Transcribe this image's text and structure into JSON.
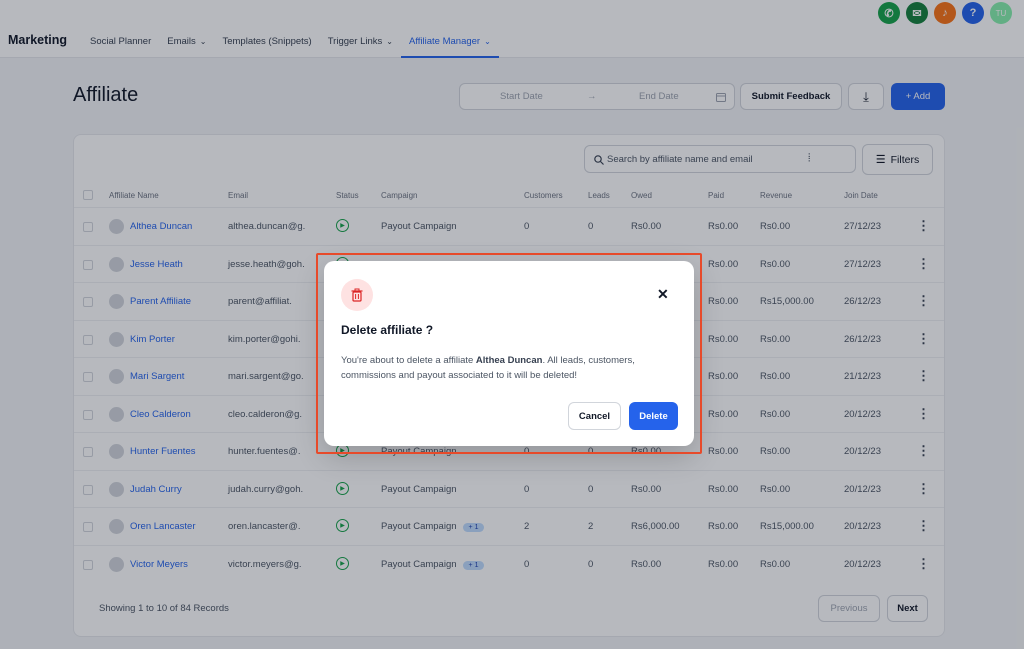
{
  "header": {
    "brand": "Marketing",
    "nav": [
      {
        "label": "Social Planner",
        "chevron": false,
        "active": false
      },
      {
        "label": "Emails",
        "chevron": true,
        "active": false
      },
      {
        "label": "Templates (Snippets)",
        "chevron": false,
        "active": false
      },
      {
        "label": "Trigger Links",
        "chevron": true,
        "active": false
      },
      {
        "label": "Affiliate Manager",
        "chevron": true,
        "active": true
      }
    ],
    "icons": [
      {
        "name": "phone-icon",
        "color": "#16a34a",
        "glyph": "✆"
      },
      {
        "name": "megaphone-icon",
        "color": "#15803d",
        "glyph": "✉"
      },
      {
        "name": "bell-icon",
        "color": "#f97316",
        "glyph": "♪"
      },
      {
        "name": "help-icon",
        "color": "#2563eb",
        "glyph": "?"
      },
      {
        "name": "user-avatar",
        "color": "#86efac",
        "glyph": "TU"
      }
    ]
  },
  "page": {
    "title": "Affiliate",
    "start_date_placeholder": "Start Date",
    "arrow": "→",
    "end_date_placeholder": "End Date",
    "submit_feedback": "Submit Feedback",
    "download_glyph": "⤓",
    "add_label": "+ Add"
  },
  "table": {
    "search_placeholder": "Search by affiliate name and email",
    "filters_label": "Filters",
    "columns": [
      "Affiliate Name",
      "Email",
      "Status",
      "Campaign",
      "Customers",
      "Leads",
      "Owed",
      "Paid",
      "Revenue",
      "Join Date"
    ],
    "rows": [
      {
        "name": "Althea Duncan",
        "email": "althea.duncan@g.",
        "campaign": "Payout Campaign",
        "badge": "",
        "customers": "0",
        "leads": "0",
        "owed": "Rs0.00",
        "paid": "Rs0.00",
        "revenue": "Rs0.00",
        "join": "27/12/23"
      },
      {
        "name": "Jesse Heath",
        "email": "jesse.heath@goh.",
        "campaign": "",
        "badge": "",
        "customers": "",
        "leads": "",
        "owed": "",
        "paid": "Rs0.00",
        "revenue": "Rs0.00",
        "join": "27/12/23"
      },
      {
        "name": "Parent Affiliate",
        "email": "parent@affiliat.",
        "campaign": "",
        "badge": "",
        "customers": "",
        "leads": "",
        "owed": "",
        "paid": "Rs0.00",
        "revenue": "Rs15,000.00",
        "join": "26/12/23"
      },
      {
        "name": "Kim Porter",
        "email": "kim.porter@gohi.",
        "campaign": "",
        "badge": "",
        "customers": "",
        "leads": "",
        "owed": "",
        "paid": "Rs0.00",
        "revenue": "Rs0.00",
        "join": "26/12/23"
      },
      {
        "name": "Mari Sargent",
        "email": "mari.sargent@go.",
        "campaign": "",
        "badge": "",
        "customers": "",
        "leads": "",
        "owed": "",
        "paid": "Rs0.00",
        "revenue": "Rs0.00",
        "join": "21/12/23"
      },
      {
        "name": "Cleo Calderon",
        "email": "cleo.calderon@g.",
        "campaign": "",
        "badge": "",
        "customers": "",
        "leads": "",
        "owed": "",
        "paid": "Rs0.00",
        "revenue": "Rs0.00",
        "join": "20/12/23"
      },
      {
        "name": "Hunter Fuentes",
        "email": "hunter.fuentes@.",
        "campaign": "Payout Campaign",
        "badge": "",
        "customers": "0",
        "leads": "0",
        "owed": "Rs0.00",
        "paid": "Rs0.00",
        "revenue": "Rs0.00",
        "join": "20/12/23"
      },
      {
        "name": "Judah Curry",
        "email": "judah.curry@goh.",
        "campaign": "Payout Campaign",
        "badge": "",
        "customers": "0",
        "leads": "0",
        "owed": "Rs0.00",
        "paid": "Rs0.00",
        "revenue": "Rs0.00",
        "join": "20/12/23"
      },
      {
        "name": "Oren Lancaster",
        "email": "oren.lancaster@.",
        "campaign": "Payout Campaign",
        "badge": "+ 1",
        "customers": "2",
        "leads": "2",
        "owed": "Rs6,000.00",
        "paid": "Rs0.00",
        "revenue": "Rs15,000.00",
        "join": "20/12/23"
      },
      {
        "name": "Victor Meyers",
        "email": "victor.meyers@g.",
        "campaign": "Payout Campaign",
        "badge": "+ 1",
        "customers": "0",
        "leads": "0",
        "owed": "Rs0.00",
        "paid": "Rs0.00",
        "revenue": "Rs0.00",
        "join": "20/12/23"
      }
    ],
    "showing": "Showing 1 to 10 of 84 Records",
    "previous": "Previous",
    "next": "Next"
  },
  "modal": {
    "title": "Delete affiliate ?",
    "body_prefix": "You're about to delete a affiliate ",
    "body_name": "Althea Duncan",
    "body_suffix": ". All leads, customers, commissions and payout associated to it will be deleted!",
    "cancel": "Cancel",
    "delete": "Delete",
    "close_glyph": "✕"
  },
  "colors": {
    "primary": "#2563eb",
    "danger": "#dc2626",
    "highlight": "#e74a2a"
  }
}
